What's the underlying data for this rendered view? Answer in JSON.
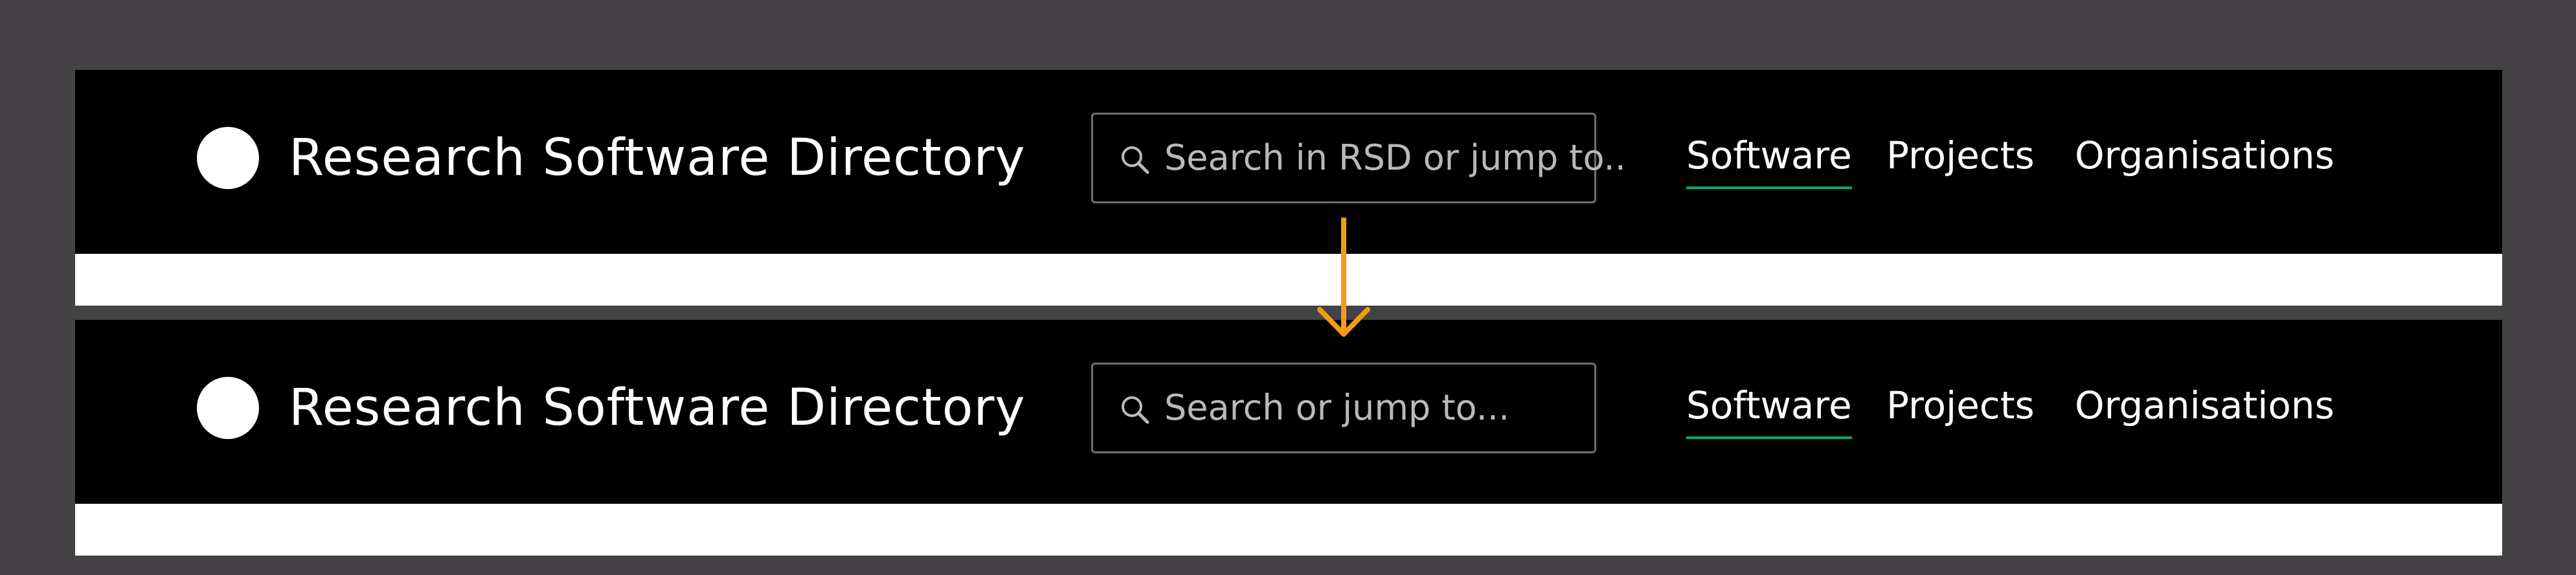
{
  "colors": {
    "canvas_background": "#444244",
    "navbar_background": "#000000",
    "panel_background": "#ffffff",
    "text_primary": "#ffffff",
    "placeholder_text": "#b9b9b9",
    "search_border": "#6f6f6f",
    "active_underline": "#0aa57a",
    "arrow_color": "#f39c12"
  },
  "icons": {
    "logo": "white-circle",
    "search": "magnifier",
    "transition": "down-arrow"
  },
  "top_navbar": {
    "brand": "Research Software Directory",
    "search_placeholder": "Search in RSD or jump to..",
    "nav": [
      "Software",
      "Projects",
      "Organisations"
    ],
    "active_nav": "Software"
  },
  "bottom_navbar": {
    "brand": "Research Software Directory",
    "search_placeholder": "Search or jump to...",
    "nav": [
      "Software",
      "Projects",
      "Organisations"
    ],
    "active_nav": "Software"
  }
}
